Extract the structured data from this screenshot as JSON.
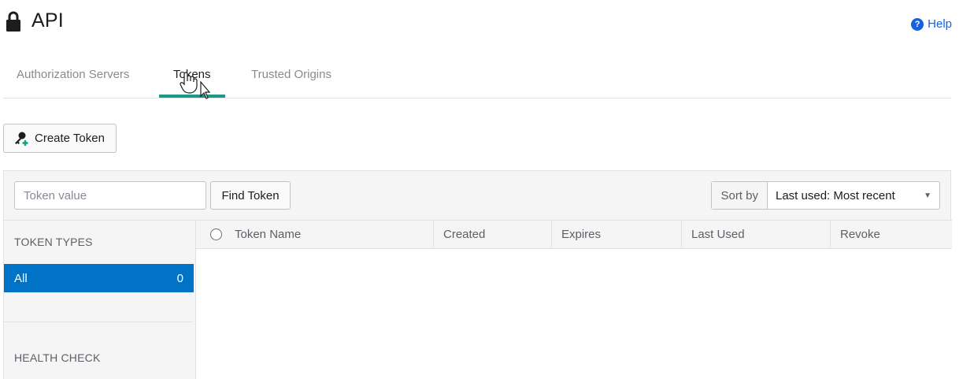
{
  "page": {
    "title": "API",
    "help_label": "Help",
    "help_icon": "question-icon",
    "title_icon": "lock-icon"
  },
  "tabs": [
    {
      "label": "Authorization Servers",
      "active": false
    },
    {
      "label": "Tokens",
      "active": true
    },
    {
      "label": "Trusted Origins",
      "active": false
    }
  ],
  "toolbar": {
    "create_label": "Create Token",
    "create_icon": "key-plus-icon"
  },
  "search": {
    "placeholder": "Token value",
    "value": "",
    "find_label": "Find Token"
  },
  "sort": {
    "label": "Sort by",
    "selected": "Last used: Most recent"
  },
  "sidebar": {
    "token_types_heading": "TOKEN TYPES",
    "items": [
      {
        "label": "All",
        "count": "0",
        "selected": true
      }
    ],
    "health_check_heading": "HEALTH CHECK"
  },
  "table": {
    "columns": [
      "Token Name",
      "Created",
      "Expires",
      "Last Used",
      "Revoke"
    ],
    "rows": []
  },
  "colors": {
    "accent": "#1a9a82",
    "selected_item": "#0073c6",
    "link": "#1662dd"
  }
}
